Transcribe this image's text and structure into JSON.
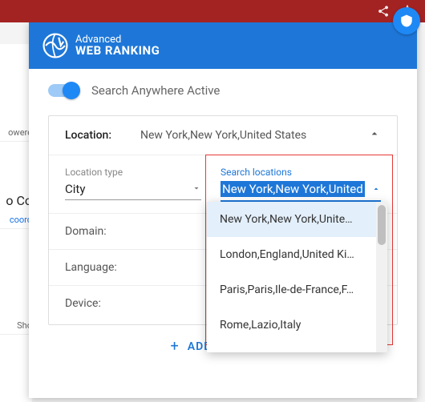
{
  "bg": {
    "powered": "owere",
    "coord_head": "o Co",
    "coord_link": "coord",
    "show": "Sho"
  },
  "brand": {
    "line1": "Advanced",
    "line2": "WEB RANKING"
  },
  "toggle": {
    "label": "Search Anywhere Active",
    "on": true
  },
  "location": {
    "label": "Location:",
    "value": "New York,New York,United States"
  },
  "type_field": {
    "label": "Location type",
    "value": "City"
  },
  "search_field": {
    "label": "Search locations",
    "value": "New York,New York,United"
  },
  "rows": {
    "domain": "Domain:",
    "language": "Language:",
    "device": "Device:"
  },
  "dropdown": {
    "items": [
      "New York,New York,Unite…",
      "London,England,United Ki…",
      "Paris,Paris,Ile-de-France,F…",
      "Rome,Lazio,Italy"
    ]
  },
  "add_location": "ADD LOCATION"
}
